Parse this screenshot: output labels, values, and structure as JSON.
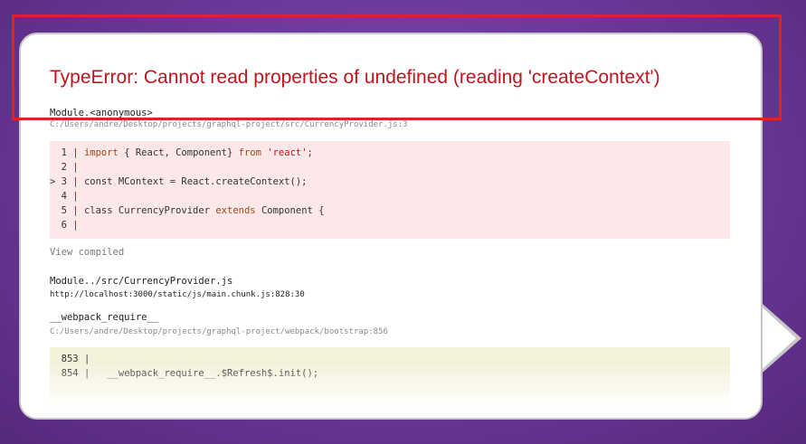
{
  "error": {
    "title": "TypeError: Cannot read properties of undefined (reading 'createContext')"
  },
  "frames": [
    {
      "function": "Module.<anonymous>",
      "file": "C:/Users/andre/Desktop/projects/graphql-project/src/CurrencyProvider.js:3",
      "code": [
        {
          "gutter": "  1 | ",
          "parts": [
            {
              "t": "import",
              "c": "kw"
            },
            {
              "t": " { React, Component} ",
              "c": ""
            },
            {
              "t": "from",
              "c": "kw"
            },
            {
              "t": " ",
              "c": ""
            },
            {
              "t": "'react'",
              "c": "str"
            },
            {
              "t": ";",
              "c": ""
            }
          ]
        },
        {
          "gutter": "  2 | ",
          "parts": []
        },
        {
          "gutter": "> 3 | ",
          "parts": [
            {
              "t": "const MContext = React.createContext();",
              "c": ""
            }
          ]
        },
        {
          "gutter": "  4 | ",
          "parts": []
        },
        {
          "gutter": "  5 | ",
          "parts": [
            {
              "t": "class CurrencyProvider ",
              "c": ""
            },
            {
              "t": "extends",
              "c": "kw"
            },
            {
              "t": " Component {",
              "c": ""
            }
          ]
        },
        {
          "gutter": "  6 | ",
          "parts": []
        }
      ]
    },
    {
      "function": "Module../src/CurrencyProvider.js",
      "file": "http://localhost:3000/static/js/main.chunk.js:828:30"
    },
    {
      "function": "__webpack_require__",
      "file": "C:/Users/andre/Desktop/projects/graphql-project/webpack/bootstrap:856",
      "code": [
        {
          "gutter": "  853 | ",
          "parts": []
        },
        {
          "gutter": "  854 | ",
          "parts": [
            {
              "t": "  __webpack_require__.$Refresh$.init();",
              "c": ""
            }
          ]
        }
      ]
    }
  ],
  "view_compiled_label": "View compiled",
  "colors": {
    "error_red": "#c0141f",
    "highlight_red": "#e0202a",
    "background_purple": "#6f3a9e",
    "code_bg_red": "#fce8e8",
    "code_bg_yellow": "#f4f1da"
  }
}
